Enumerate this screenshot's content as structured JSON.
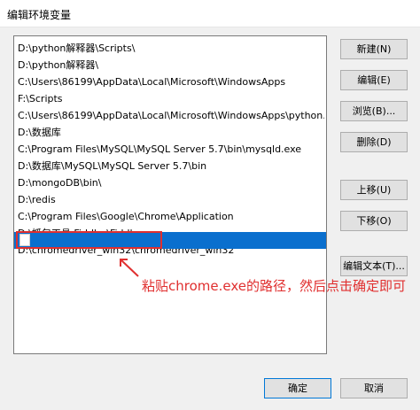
{
  "window": {
    "title": "编辑环境变量"
  },
  "paths": [
    "D:\\python解释器\\Scripts\\",
    "D:\\python解释器\\",
    "C:\\Users\\86199\\AppData\\Local\\Microsoft\\WindowsApps",
    "F:\\Scripts",
    "C:\\Users\\86199\\AppData\\Local\\Microsoft\\WindowsApps\\python....",
    "D:\\数据库",
    "C:\\Program Files\\MySQL\\MySQL Server 5.7\\bin\\mysqld.exe",
    "D:\\数据库\\MySQL\\MySQL Server 5.7\\bin",
    "D:\\mongoDB\\bin\\",
    "D:\\redis",
    "C:\\Program Files\\Google\\Chrome\\Application",
    "D:\\抓包工具 Fiddler\\Fiddler",
    "D:\\chromedriver_win32\\chromedriver_win32"
  ],
  "selected_value": "",
  "buttons": {
    "new": "新建(N)",
    "edit": "编辑(E)",
    "browse": "浏览(B)...",
    "delete": "删除(D)",
    "move_up": "上移(U)",
    "move_down": "下移(O)",
    "edit_text": "编辑文本(T)...",
    "ok": "确定",
    "cancel": "取消"
  },
  "annotation": "粘贴chrome.exe的路径，然后点击确定即可",
  "colors": {
    "selection": "#0a6fce",
    "annotation": "#e02f2f"
  }
}
